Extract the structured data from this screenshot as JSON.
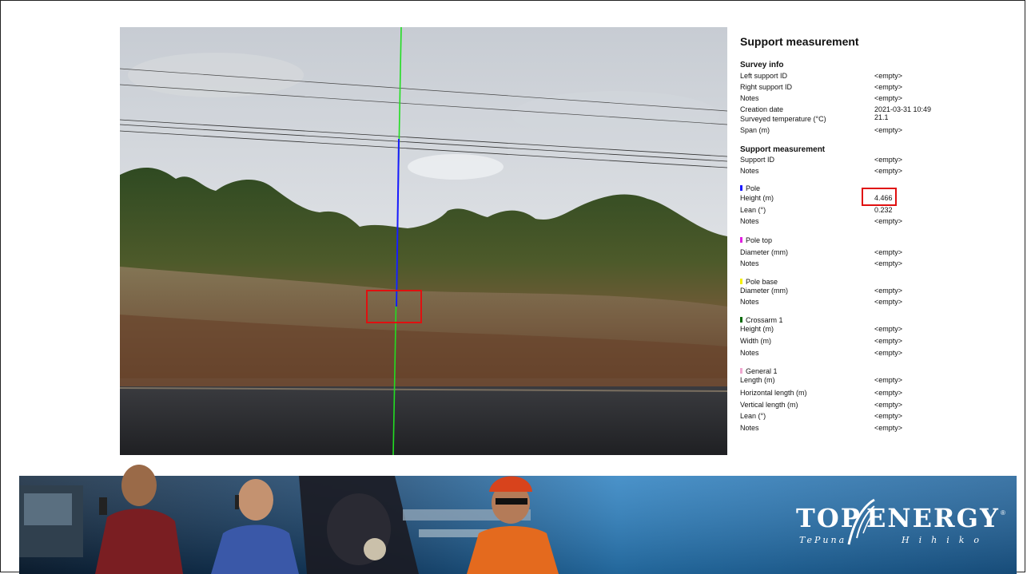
{
  "panel": {
    "title": "Support measurement",
    "survey_info": {
      "heading": "Survey info",
      "rows": [
        {
          "label": "Left support ID",
          "value": "<empty>"
        },
        {
          "label": "Right support ID",
          "value": "<empty>"
        },
        {
          "label": "Notes",
          "value": "<empty>"
        },
        {
          "label": "Creation date",
          "value": "2021-03-31 10:49"
        },
        {
          "label": "Surveyed temperature (°C)",
          "value": "21.1"
        },
        {
          "label": "Span (m)",
          "value": "<empty>"
        }
      ]
    },
    "support_measurement": {
      "heading": "Support measurement",
      "rows": [
        {
          "label": "Support ID",
          "value": "<empty>"
        },
        {
          "label": "Notes",
          "value": "<empty>"
        }
      ]
    },
    "pole": {
      "name": "Pole",
      "color": "#1a1aff",
      "rows": [
        {
          "label": "Height (m)",
          "value": "4.466"
        },
        {
          "label": "Lean (°)",
          "value": "0.232"
        },
        {
          "label": "Notes",
          "value": "<empty>"
        }
      ]
    },
    "pole_top": {
      "name": "Pole top",
      "color": "#e020e0",
      "rows": [
        {
          "label": "Diameter (mm)",
          "value": "<empty>"
        },
        {
          "label": "Notes",
          "value": "<empty>"
        }
      ]
    },
    "pole_base": {
      "name": "Pole base",
      "color": "#f5f000",
      "rows": [
        {
          "label": "Diameter (mm)",
          "value": "<empty>"
        },
        {
          "label": "Notes",
          "value": "<empty>"
        }
      ]
    },
    "crossarm": {
      "name": "Crossarm 1",
      "color": "#0a6a0a",
      "rows": [
        {
          "label": "Height (m)",
          "value": "<empty>"
        },
        {
          "label": "Width (m)",
          "value": "<empty>"
        },
        {
          "label": "Notes",
          "value": "<empty>"
        }
      ]
    },
    "general": {
      "name": "General 1",
      "color": "#f0a8d0",
      "rows": [
        {
          "label": "Length (m)",
          "value": "<empty>"
        },
        {
          "label": "Horizontal length (m)",
          "value": "<empty>"
        },
        {
          "label": "Vertical length (m)",
          "value": "<empty>"
        },
        {
          "label": "Lean (°)",
          "value": "<empty>"
        },
        {
          "label": "Notes",
          "value": "<empty>"
        }
      ]
    }
  },
  "logo": {
    "word_left": "TOP",
    "word_right": "ENERGY",
    "registered": "®",
    "sub_left": "TePuna",
    "sub_right": "Hihiko"
  },
  "colors": {
    "highlight": "#e01010",
    "measure_line": "#22dd22",
    "pole_line": "#1a1aff",
    "banner_blue": "#2a7fc0"
  }
}
